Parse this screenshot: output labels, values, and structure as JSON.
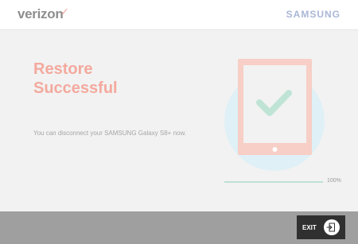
{
  "header": {
    "left_brand": "verizon",
    "left_brand_mark": "✓",
    "right_brand": "SAMSUNG"
  },
  "main": {
    "title_line1": "Restore",
    "title_line2": "Successful",
    "message": "You can disconnect your SAMSUNG Galaxy S8+ now.",
    "illustration_icon": "tablet-check-icon"
  },
  "progress": {
    "value": 100,
    "label": "100%"
  },
  "footer": {
    "exit_label": "EXIT",
    "exit_icon": "exit-door-icon"
  },
  "colors": {
    "accent": "#f4a99e",
    "check": "#bfe4d6",
    "circle": "#dff0f6",
    "footer": "#9f9f9f",
    "exit_button": "#303030"
  }
}
